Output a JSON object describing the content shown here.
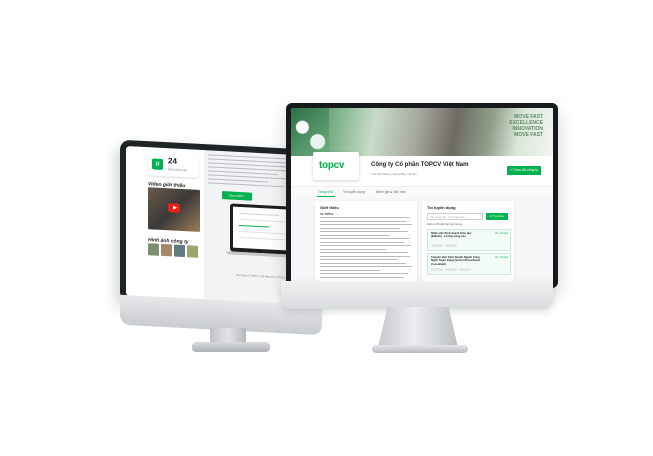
{
  "back_screen": {
    "stat_number": "24",
    "stat_label": "Giới công việc",
    "video_title": "Video giới thiệu",
    "gallery_title": "Hình ảnh công ty",
    "visit_button": "Xem thêm ›",
    "footer_note": "Việc làm tại TOPCV Việt Nam với 1,000 tin"
  },
  "front_screen": {
    "cover_text": [
      "MOVE FAST",
      "EXCELLENCE",
      "INNOVATION",
      "MOVE FAST"
    ],
    "logo": "topcv",
    "company_name": "Công ty Cổ phần TOPCV Việt Nam",
    "company_meta": "Tòa FS Palazo, Hàng Đẫy, Hà Nội",
    "follow_button": "+ Theo dõi công ty",
    "tabs": [
      "Trang chủ",
      "Tin tuyển dụng",
      "Đánh giá & Văn hóa"
    ],
    "intro_title": "Giới thiệu",
    "intro_subtitle": "Về TOPCV",
    "jobs_title": "Tin tuyển dụng",
    "search_placeholder": "Tên công việc, vị trí ứng tuyển",
    "search_button": "Q Tìm kiếm",
    "jobs_count": "Hiện có 89 việc làm tại công ty",
    "jobs": [
      {
        "title": "Nhân viên Kinh doanh Giáo dục (Edtech) - Lương cứng cao",
        "salary": "10 - 20 triệu"
      },
      {
        "title": "Chuyên Viên Kinh Doanh Ngành Công Nghệ Tuyển Dụng (Senior Recruitment Consultant)",
        "salary": "15 - 30 triệu"
      }
    ]
  }
}
